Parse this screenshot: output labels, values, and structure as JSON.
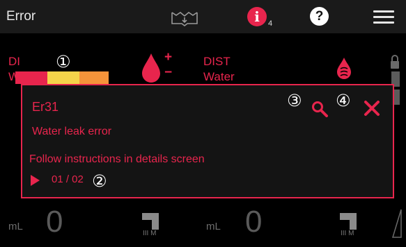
{
  "header": {
    "title": "Error",
    "notification_count": "4",
    "info_glyph": "i",
    "help_glyph": "?"
  },
  "background": {
    "left_tank_label_1": "DI",
    "left_tank_label_2": "W",
    "right_tank_label_1": "DIST",
    "right_tank_label_2": "Water",
    "plus": "+",
    "minus": "−",
    "left_bottom_unit": "mL",
    "left_bottom_value": "0",
    "left_bottom_sub": "III M",
    "right_bottom_unit": "mL",
    "right_bottom_value": "0",
    "right_bottom_sub": "III M"
  },
  "callouts": {
    "c1": "①",
    "c2": "②",
    "c3": "③",
    "c4": "④"
  },
  "dialog": {
    "code": "Er31",
    "message": "Water leak error",
    "instruction": "Follow instructions in details screen",
    "pager": "01 / 02"
  },
  "colors": {
    "accent": "#e8254d",
    "bar_red": "#e8254d",
    "bar_yellow": "#f5d44a",
    "bar_orange": "#f5943a"
  },
  "icons": {
    "mode": "book-droplet-icon",
    "info": "info-icon",
    "help": "help-icon",
    "menu": "hamburger-menu-icon",
    "search": "search-icon",
    "close": "close-icon",
    "play": "play-icon",
    "lock": "lock-icon"
  }
}
